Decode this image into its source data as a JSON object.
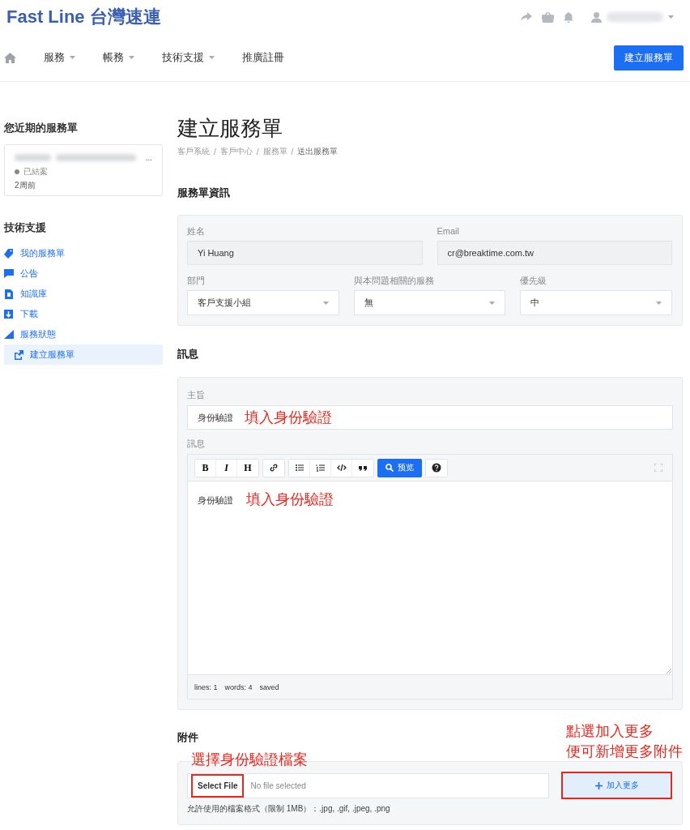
{
  "header": {
    "logo": "Fast Line 台灣速連"
  },
  "nav": {
    "items": [
      {
        "label": "服務",
        "dropdown": true
      },
      {
        "label": "帳務",
        "dropdown": true
      },
      {
        "label": "技術支援",
        "dropdown": true
      },
      {
        "label": "推廣註冊",
        "dropdown": false
      }
    ],
    "cta": "建立服務單"
  },
  "sidebar": {
    "recent_title": "您近期的服務單",
    "recent_ticket": {
      "more": "...",
      "status": "已結案",
      "time": "2周前"
    },
    "support_title": "技術支援",
    "items": [
      {
        "label": "我的服務單",
        "selected": false
      },
      {
        "label": "公告",
        "selected": false
      },
      {
        "label": "知識庫",
        "selected": false
      },
      {
        "label": "下載",
        "selected": false
      },
      {
        "label": "服務狀態",
        "selected": false,
        "children": [
          {
            "label": "建立服務單",
            "selected": true
          }
        ]
      }
    ]
  },
  "page": {
    "title": "建立服務單",
    "breadcrumb": [
      "客戶系統",
      "客戶中心",
      "服務單",
      "送出服務單"
    ],
    "separator": "/"
  },
  "info_section": {
    "title": "服務單資訊",
    "fields": [
      {
        "label": "姓名",
        "value": "Yi Huang",
        "kind": "text"
      },
      {
        "label": "Email",
        "value": "cr@breaktime.com.tw",
        "kind": "text"
      },
      {
        "label": "部門",
        "value": "客戶支援小組",
        "kind": "select"
      },
      {
        "label": "與本問題相關的服務",
        "value": "無",
        "kind": "select"
      },
      {
        "label": "優先級",
        "value": "中",
        "kind": "select"
      }
    ]
  },
  "message_section": {
    "title": "訊息",
    "subject": {
      "label": "主旨",
      "value": "身份驗證",
      "annotation": "填入身份驗證"
    },
    "editor": {
      "label": "訊息",
      "text_buttons": [
        "B",
        "I",
        "H"
      ],
      "preview": "预览",
      "body": "身份驗證",
      "annotation": "填入身份驗證",
      "status": [
        "lines: 1",
        "words: 4",
        "saved"
      ]
    }
  },
  "attachments": {
    "title": "附件",
    "select_button": "Select File",
    "placeholder": "No file selected",
    "hint": "允許使用的檔案格式（限制 1MB）：.jpg, .gif, .jpeg, .png",
    "add_more": "加入更多",
    "file_annotation": "選擇身份驗證檔案",
    "add_annotation": [
      "點選加入更多",
      "便可新增更多附件"
    ]
  }
}
